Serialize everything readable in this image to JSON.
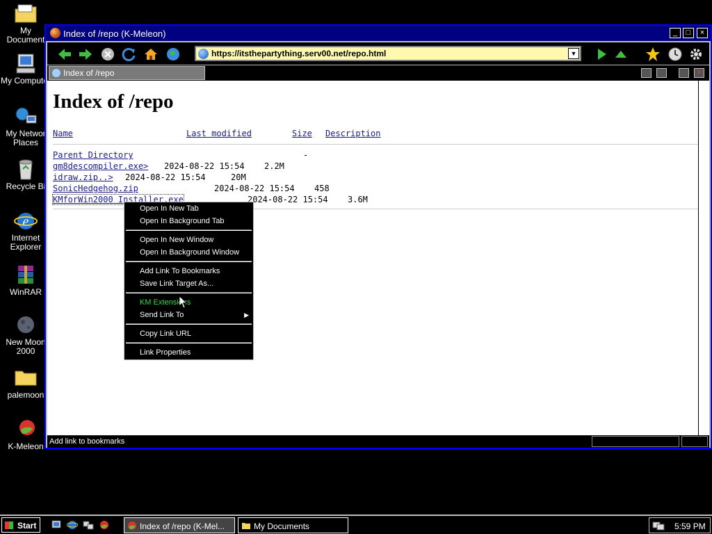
{
  "desktop": {
    "icons": [
      {
        "name": "my-documents",
        "label": "My Document"
      },
      {
        "name": "my-computer",
        "label": "My Computer"
      },
      {
        "name": "my-network-places",
        "label": "My Networ Places"
      },
      {
        "name": "recycle-bin",
        "label": "Recycle Bi"
      },
      {
        "name": "internet-explorer",
        "label": "Internet Explorer"
      },
      {
        "name": "winrar",
        "label": "WinRAR"
      },
      {
        "name": "new-moon",
        "label": "New Moon 2000"
      },
      {
        "name": "palemoon",
        "label": "palemoon"
      },
      {
        "name": "k-meleon",
        "label": "K-Meleon"
      }
    ]
  },
  "window": {
    "title": "Index of /repo (K-Meleon)",
    "url": "https://itsthepartything.serv00.net/repo.html",
    "tab_title": "Index of /repo",
    "status_text": "Add link to bookmarks"
  },
  "page": {
    "heading": "Index of /repo",
    "columns": {
      "name": "Name",
      "last_modified": "Last modified",
      "size": "Size",
      "description": "Description"
    },
    "parent": {
      "name": "Parent Directory",
      "size": "-"
    },
    "rows": [
      {
        "name": "gm8descompiler.exe>",
        "date": "2024-08-22 15:54",
        "size": "2.2M"
      },
      {
        "name": "idraw.zip..>",
        "date": "2024-08-22 15:54",
        "size": "20M"
      },
      {
        "name": "SonicHedgehog.zip",
        "date": "2024-08-22 15:54",
        "size": "458"
      },
      {
        "name": "KMforWin2000 Installer.exe",
        "date": "2024-08-22 15:54",
        "size": "3.6M"
      }
    ]
  },
  "context_menu": {
    "items": [
      "Open In New Tab",
      "Open In Background Tab",
      "Open In New Window",
      "Open In Background Window",
      "Add Link To Bookmarks",
      "Save Link Target As...",
      "KM Extensions",
      "Send Link To",
      "Copy Link URL",
      "Link Properties"
    ]
  },
  "taskbar": {
    "start_label": "Start",
    "tasks": [
      "Index of /repo (K-Mel...",
      "My Documents"
    ],
    "clock": "5:59 PM"
  },
  "colors": {
    "titlebar": "#000080",
    "window_border": "#0000ff",
    "url_bg": "#fff9b0",
    "menu_highlight_text": "#3bd44a",
    "link": "#1a1a8c"
  }
}
